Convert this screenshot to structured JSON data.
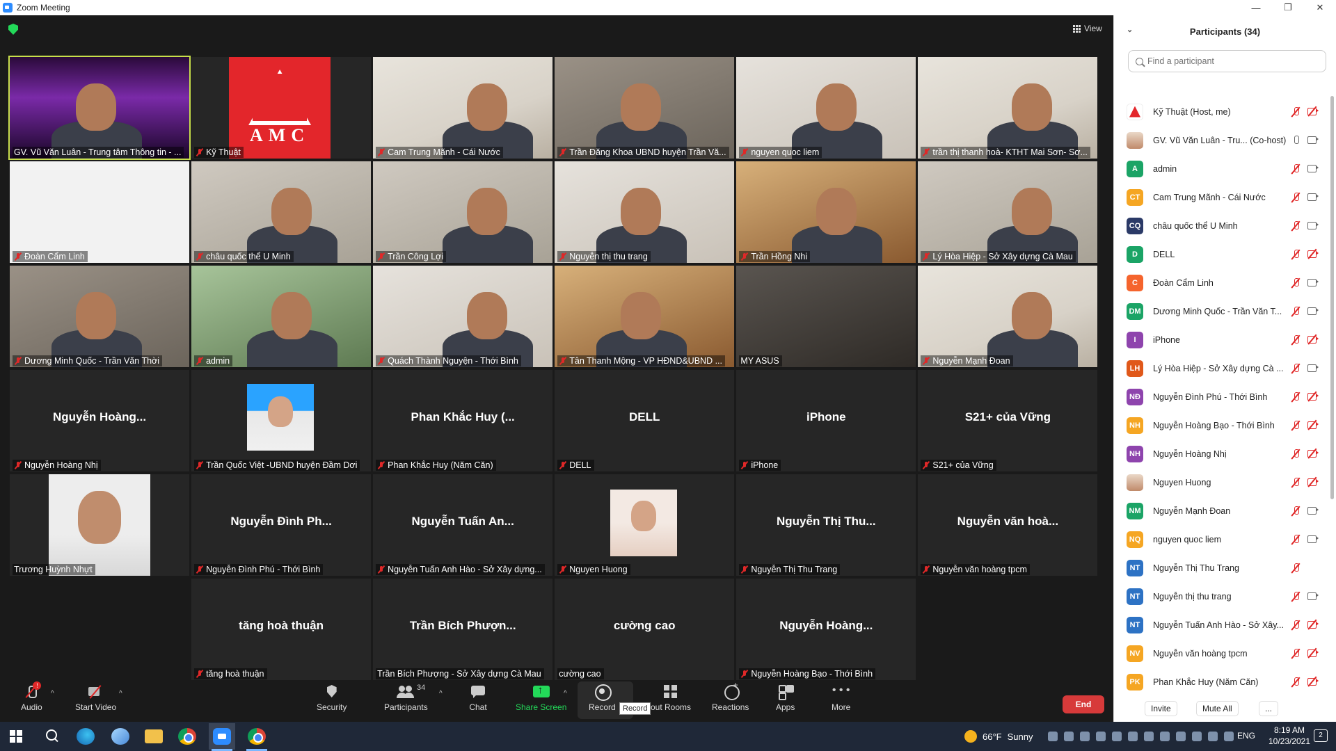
{
  "window": {
    "title": "Zoom Meeting"
  },
  "stage": {
    "view_label": "View"
  },
  "tiles": [
    {
      "label": "GV. Vũ Văn Luân - Trung tâm Thông tin - ...",
      "muted": false,
      "kind": "video"
    },
    {
      "label": "Kỹ Thuật",
      "muted": true,
      "kind": "logo"
    },
    {
      "label": "Cam Trung Mãnh - Cái Nước",
      "muted": true,
      "kind": "video"
    },
    {
      "label": "Trần Đăng Khoa UBND huyện Trần Vă...",
      "muted": true,
      "kind": "video"
    },
    {
      "label": "nguyen quoc liem",
      "muted": true,
      "kind": "video"
    },
    {
      "label": "trần thị thanh hoà- KTHT Mai Sơn- Sơ...",
      "muted": true,
      "kind": "video"
    },
    {
      "label": "Đoàn Cẩm Linh",
      "muted": true,
      "kind": "video"
    },
    {
      "label": "châu quốc thể U Minh",
      "muted": true,
      "kind": "video"
    },
    {
      "label": "Trần Công Lợi",
      "muted": true,
      "kind": "video"
    },
    {
      "label": "Nguyễn thị thu trang",
      "muted": true,
      "kind": "video"
    },
    {
      "label": "Trần Hồng Nhi",
      "muted": true,
      "kind": "video"
    },
    {
      "label": "Lý Hòa Hiệp - Sở Xây dựng Cà Mau",
      "muted": true,
      "kind": "video"
    },
    {
      "label": "Dương Minh Quốc - Trần Văn Thời",
      "muted": true,
      "kind": "video"
    },
    {
      "label": "admin",
      "muted": true,
      "kind": "video"
    },
    {
      "label": "Quách Thành Nguyện - Thới Bình",
      "muted": true,
      "kind": "video"
    },
    {
      "label": "Tân Thanh Mộng - VP HĐND&UBND ...",
      "muted": true,
      "kind": "video"
    },
    {
      "label": "MY ASUS",
      "muted": false,
      "kind": "video"
    },
    {
      "label": "Nguyễn Mạnh Đoan",
      "muted": true,
      "kind": "video"
    },
    {
      "label": "Nguyễn Hoàng Nhị",
      "muted": true,
      "kind": "name",
      "center": "Nguyễn Hoàng..."
    },
    {
      "label": "Trần Quốc Việt -UBND huyện Đầm Dơi",
      "muted": true,
      "kind": "photo"
    },
    {
      "label": "Phan Khắc Huy (Năm Căn)",
      "muted": true,
      "kind": "name",
      "center": "Phan Khắc Huy (..."
    },
    {
      "label": "DELL",
      "muted": true,
      "kind": "name",
      "center": "DELL"
    },
    {
      "label": "iPhone",
      "muted": true,
      "kind": "name",
      "center": "iPhone"
    },
    {
      "label": "S21+ của Vững",
      "muted": true,
      "kind": "name",
      "center": "S21+ của Vững"
    },
    {
      "label": "Trương Huỳnh Nhựt",
      "muted": false,
      "kind": "photo"
    },
    {
      "label": "Nguyễn Đình Phú - Thới Bình",
      "muted": true,
      "kind": "name",
      "center": "Nguyễn Đình Ph..."
    },
    {
      "label": "Nguyễn Tuấn Anh Hào - Sở Xây dựng...",
      "muted": true,
      "kind": "name",
      "center": "Nguyễn Tuấn An..."
    },
    {
      "label": "Nguyen Huong",
      "muted": true,
      "kind": "photo"
    },
    {
      "label": "Nguyễn Thị Thu Trang",
      "muted": true,
      "kind": "name",
      "center": "Nguyễn Thị Thu..."
    },
    {
      "label": "Nguyễn văn hoàng tpcm",
      "muted": true,
      "kind": "name",
      "center": "Nguyễn văn hoà..."
    },
    {
      "label": "tăng hoà thuận",
      "muted": true,
      "kind": "name",
      "center": "tăng hoà thuận"
    },
    {
      "label": "Trần Bích Phượng - Sở Xây dựng Cà Mau",
      "muted": false,
      "kind": "name",
      "center": "Trần Bích Phượn..."
    },
    {
      "label": "cường cao",
      "muted": false,
      "kind": "name",
      "center": "cường cao"
    },
    {
      "label": "Nguyễn Hoàng Bạo - Thới Bình",
      "muted": true,
      "kind": "name",
      "center": "Nguyễn Hoàng..."
    }
  ],
  "toolbar": {
    "audio": "Audio",
    "audio_badge": "!",
    "video": "Start Video",
    "security": "Security",
    "participants": "Participants",
    "participants_count": "34",
    "chat": "Chat",
    "share": "Share Screen",
    "record": "Record",
    "record_tooltip": "Record",
    "breakout": "out Rooms",
    "reactions": "Reactions",
    "apps": "Apps",
    "more": "More",
    "end": "End"
  },
  "panel": {
    "title": "Participants (34)",
    "search_placeholder": "Find a participant",
    "invite": "Invite",
    "mute_all": "Mute All",
    "more": "...",
    "participants": [
      {
        "name": "Kỹ Thuật (Host, me)",
        "initials": "",
        "avatar": "logo",
        "color": "#ffffff",
        "mic": "off",
        "cam": "off"
      },
      {
        "name": "GV. Vũ Văn Luân - Tru... (Co-host)",
        "initials": "",
        "avatar": "photo",
        "color": "#8a8a8a",
        "mic": "on",
        "cam": "on"
      },
      {
        "name": "admin",
        "initials": "A",
        "avatar": "initials",
        "color": "#1ba466",
        "mic": "off",
        "cam": "on"
      },
      {
        "name": "Cam Trung Mãnh - Cái Nước",
        "initials": "CT",
        "avatar": "initials",
        "color": "#f5a623",
        "mic": "off",
        "cam": "on"
      },
      {
        "name": "châu quốc thể U Minh",
        "initials": "CQ",
        "avatar": "initials",
        "color": "#2b3a67",
        "mic": "off",
        "cam": "on"
      },
      {
        "name": "DELL",
        "initials": "D",
        "avatar": "initials",
        "color": "#1ba466",
        "mic": "off",
        "cam": "off"
      },
      {
        "name": "Đoàn Cẩm Linh",
        "initials": "C",
        "avatar": "initials",
        "color": "#f5642d",
        "mic": "off",
        "cam": "on"
      },
      {
        "name": "Dương Minh Quốc - Trần Văn T...",
        "initials": "DM",
        "avatar": "initials",
        "color": "#1ba466",
        "mic": "off",
        "cam": "on"
      },
      {
        "name": "iPhone",
        "initials": "I",
        "avatar": "initials",
        "color": "#8e44ad",
        "mic": "off",
        "cam": "off"
      },
      {
        "name": "Lý Hòa Hiệp - Sở Xây dựng Cà ...",
        "initials": "LH",
        "avatar": "initials",
        "color": "#e0581a",
        "mic": "off",
        "cam": "on"
      },
      {
        "name": "Nguyễn Đình Phú - Thới Bình",
        "initials": "NĐ",
        "avatar": "initials",
        "color": "#8e44ad",
        "mic": "off",
        "cam": "off"
      },
      {
        "name": "Nguyễn Hoàng Bạo - Thới Bình",
        "initials": "NH",
        "avatar": "initials",
        "color": "#f5a623",
        "mic": "off",
        "cam": "off"
      },
      {
        "name": "Nguyễn Hoàng Nhị",
        "initials": "NH",
        "avatar": "initials",
        "color": "#8e44ad",
        "mic": "off",
        "cam": "off"
      },
      {
        "name": "Nguyen Huong",
        "initials": "",
        "avatar": "photo",
        "color": "#c08a6a",
        "mic": "off",
        "cam": "off"
      },
      {
        "name": "Nguyễn Mạnh Đoan",
        "initials": "NM",
        "avatar": "initials",
        "color": "#1ba466",
        "mic": "off",
        "cam": "on"
      },
      {
        "name": "nguyen quoc liem",
        "initials": "NQ",
        "avatar": "initials",
        "color": "#f5a623",
        "mic": "off",
        "cam": "on"
      },
      {
        "name": "Nguyễn Thị Thu Trang",
        "initials": "NT",
        "avatar": "initials",
        "color": "#2d72c4",
        "mic": "off",
        "cam": "none"
      },
      {
        "name": "Nguyễn thị thu trang",
        "initials": "NT",
        "avatar": "initials",
        "color": "#2d72c4",
        "mic": "off",
        "cam": "on"
      },
      {
        "name": "Nguyễn Tuấn Anh Hào - Sở Xây...",
        "initials": "NT",
        "avatar": "initials",
        "color": "#2d72c4",
        "mic": "off",
        "cam": "off"
      },
      {
        "name": "Nguyễn văn hoàng tpcm",
        "initials": "NV",
        "avatar": "initials",
        "color": "#f5a623",
        "mic": "off",
        "cam": "off"
      },
      {
        "name": "Phan Khắc Huy (Năm Căn)",
        "initials": "PK",
        "avatar": "initials",
        "color": "#f5a623",
        "mic": "off",
        "cam": "off"
      }
    ]
  },
  "taskbar": {
    "weather_temp": "66°F",
    "weather_desc": "Sunny",
    "lang": "ENG",
    "time": "8:19 AM",
    "date": "10/23/2021",
    "notifications": "2"
  }
}
